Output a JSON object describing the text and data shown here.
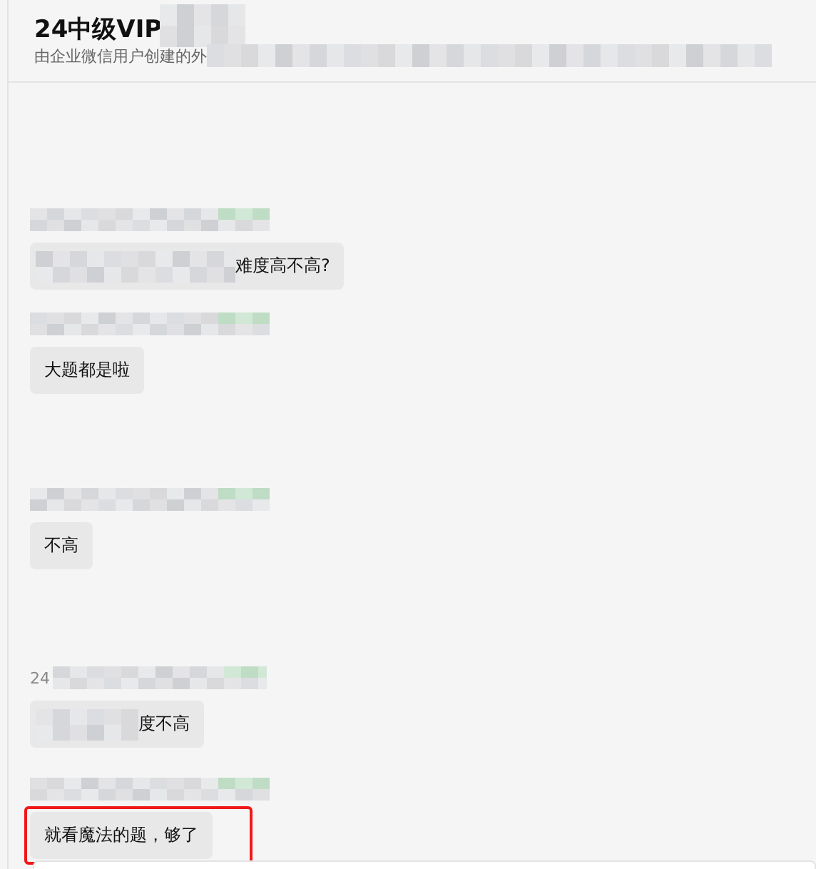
{
  "header": {
    "title": "24中级VIP",
    "subtitle": "由企业微信用户创建的外"
  },
  "messages": [
    {
      "text": "难度高不高?",
      "text_redacted": true,
      "highlighted": false
    },
    {
      "text": "大题都是啦",
      "text_redacted": false,
      "highlighted": false
    },
    {
      "text": "不高",
      "text_redacted": false,
      "highlighted": false
    },
    {
      "sender": "24",
      "text": "度不高",
      "text_redacted": true,
      "highlighted": false
    },
    {
      "text": "就看魔法的题，够了",
      "text_redacted": false,
      "highlighted": true
    }
  ]
}
